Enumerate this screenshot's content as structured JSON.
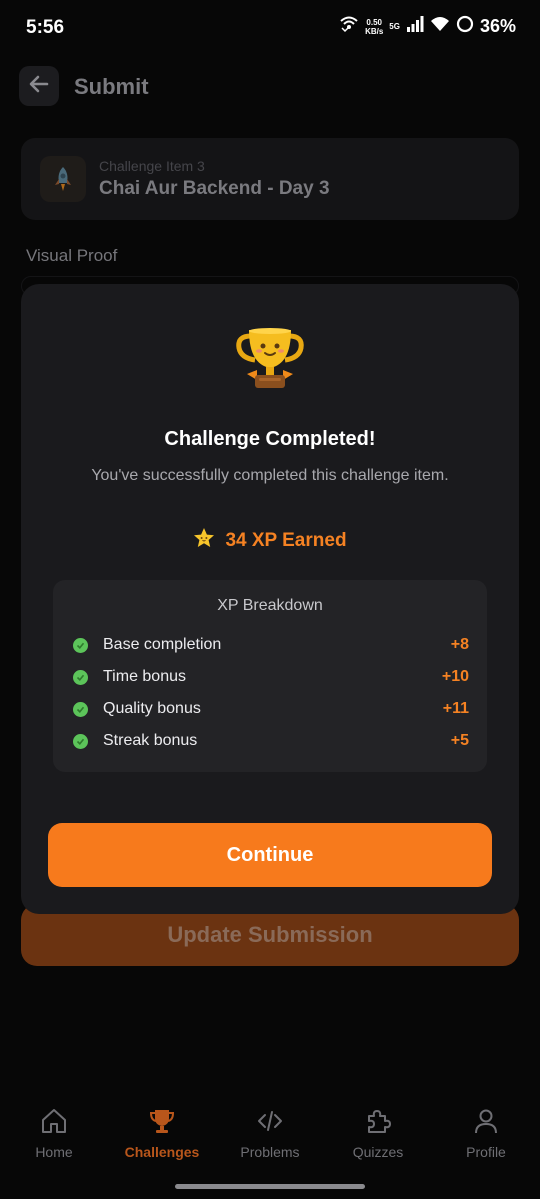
{
  "status_bar": {
    "time": "5:56",
    "net_speed_value": "0.50",
    "net_speed_unit": "KB/s",
    "network_type": "5G",
    "battery": "36%"
  },
  "header": {
    "title": "Submit",
    "back_icon": "arrow-left-icon"
  },
  "challenge_item": {
    "subtitle": "Challenge Item 3",
    "title": "Chai Aur Backend - Day 3",
    "icon": "rocket-icon"
  },
  "visual_proof": {
    "label": "Visual Proof"
  },
  "update_button": {
    "label": "Update Submission"
  },
  "modal": {
    "icon": "trophy-icon",
    "title": "Challenge Completed!",
    "subtitle": "You've successfully completed this challenge item.",
    "xp_icon": "star-icon",
    "xp_earned": "34 XP Earned",
    "breakdown": {
      "title": "XP Breakdown",
      "items": [
        {
          "label": "Base completion",
          "value": "+8"
        },
        {
          "label": "Time bonus",
          "value": "+10"
        },
        {
          "label": "Quality bonus",
          "value": "+11"
        },
        {
          "label": "Streak bonus",
          "value": "+5"
        }
      ]
    },
    "continue_label": "Continue"
  },
  "bottom_nav": {
    "items": [
      {
        "label": "Home",
        "icon": "home-icon",
        "active": false
      },
      {
        "label": "Challenges",
        "icon": "trophy-icon",
        "active": true
      },
      {
        "label": "Problems",
        "icon": "code-icon",
        "active": false
      },
      {
        "label": "Quizzes",
        "icon": "puzzle-icon",
        "active": false
      },
      {
        "label": "Profile",
        "icon": "user-icon",
        "active": false
      }
    ]
  },
  "colors": {
    "accent": "#f77a1c",
    "xp_text": "#f58223",
    "check_green": "#5cc45a",
    "modal_bg": "#1a1a1d",
    "active_nav": "#b8561b"
  }
}
